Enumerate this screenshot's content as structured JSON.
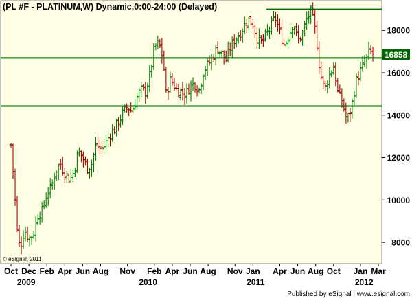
{
  "chart_data": {
    "type": "ohlc",
    "title": "(PL #F - PLATINUM,W) Dynamic,0:00-24:00 (Delayed)",
    "ylim": [
      7000,
      19400
    ],
    "y_ticks": [
      8000,
      10000,
      12000,
      14000,
      16000,
      18000
    ],
    "y_tick_labels": [
      "8000",
      "10000",
      "12000",
      "14000",
      "16000",
      "18000"
    ],
    "x_month_labels": [
      {
        "label": "Oct",
        "t": 0.0
      },
      {
        "label": "Dec",
        "t": 2.0
      },
      {
        "label": "Feb",
        "t": 4.0
      },
      {
        "label": "Apr",
        "t": 6.0
      },
      {
        "label": "Jun",
        "t": 8.0
      },
      {
        "label": "Aug",
        "t": 10.0
      },
      {
        "label": "Nov",
        "t": 13.0
      },
      {
        "label": "Feb",
        "t": 16.0
      },
      {
        "label": "Apr",
        "t": 18.0
      },
      {
        "label": "Jun",
        "t": 20.0
      },
      {
        "label": "Aug",
        "t": 22.0
      },
      {
        "label": "Nov",
        "t": 25.0
      },
      {
        "label": "Jan",
        "t": 27.0
      },
      {
        "label": "Apr",
        "t": 30.0
      },
      {
        "label": "Jun",
        "t": 32.0
      },
      {
        "label": "Aug",
        "t": 34.0
      },
      {
        "label": "Oct",
        "t": 36.0
      },
      {
        "label": "Jan",
        "t": 39.0
      },
      {
        "label": "Mar",
        "t": 41.0
      }
    ],
    "x_year_labels": [
      {
        "label": "2009",
        "t": 1.7
      },
      {
        "label": "2010",
        "t": 15.3
      },
      {
        "label": "2011",
        "t": 27.3
      },
      {
        "label": "2012",
        "t": 39.4
      }
    ],
    "horizontal_lines": [
      18990,
      16700,
      14430
    ],
    "last_price": "16858",
    "watermark": "© eSignal, 2011",
    "footer": "Published by eSignal | www.esignal.com",
    "colors": {
      "plot_background": "#ffffe6",
      "frame_background": "#ffffff",
      "up_bar": "#008000",
      "down_bar": "#b00000",
      "level_line": "#006400",
      "price_box": "#006400",
      "price_text": "#ffffff"
    },
    "anchors": [
      [
        0.0,
        12600
      ],
      [
        0.3,
        11000
      ],
      [
        0.7,
        8500
      ],
      [
        1.0,
        7700
      ],
      [
        1.5,
        8600
      ],
      [
        2.0,
        8200
      ],
      [
        2.5,
        8400
      ],
      [
        3.0,
        9300
      ],
      [
        3.5,
        9500
      ],
      [
        4.0,
        10300
      ],
      [
        4.5,
        10600
      ],
      [
        5.0,
        11400
      ],
      [
        5.5,
        11700
      ],
      [
        6.0,
        11300
      ],
      [
        6.5,
        11000
      ],
      [
        7.0,
        11300
      ],
      [
        7.5,
        12300
      ],
      [
        8.0,
        12000
      ],
      [
        8.5,
        11500
      ],
      [
        9.0,
        11700
      ],
      [
        9.5,
        12600
      ],
      [
        10.0,
        12400
      ],
      [
        10.5,
        12600
      ],
      [
        11.0,
        13100
      ],
      [
        11.5,
        13300
      ],
      [
        12.0,
        13700
      ],
      [
        12.5,
        14100
      ],
      [
        13.0,
        14400
      ],
      [
        13.5,
        14200
      ],
      [
        14.0,
        14800
      ],
      [
        14.5,
        15200
      ],
      [
        15.0,
        15100
      ],
      [
        15.5,
        15900
      ],
      [
        16.0,
        17200
      ],
      [
        16.5,
        17400
      ],
      [
        17.0,
        16600
      ],
      [
        17.3,
        15000
      ],
      [
        17.8,
        15700
      ],
      [
        18.5,
        15200
      ],
      [
        19.5,
        15000
      ],
      [
        20.0,
        15400
      ],
      [
        20.5,
        15500
      ],
      [
        21.0,
        15200
      ],
      [
        21.5,
        16100
      ],
      [
        22.0,
        16400
      ],
      [
        22.5,
        16700
      ],
      [
        23.0,
        17200
      ],
      [
        23.5,
        16900
      ],
      [
        24.0,
        16600
      ],
      [
        24.5,
        17200
      ],
      [
        25.0,
        17600
      ],
      [
        25.5,
        17800
      ],
      [
        26.0,
        18200
      ],
      [
        26.5,
        18500
      ],
      [
        27.0,
        18300
      ],
      [
        27.5,
        17600
      ],
      [
        28.0,
        17400
      ],
      [
        28.5,
        17800
      ],
      [
        29.0,
        18200
      ],
      [
        29.5,
        18600
      ],
      [
        30.0,
        17900
      ],
      [
        30.5,
        17300
      ],
      [
        31.0,
        17800
      ],
      [
        31.5,
        18400
      ],
      [
        32.0,
        17500
      ],
      [
        32.5,
        17800
      ],
      [
        33.0,
        18500
      ],
      [
        33.5,
        18900
      ],
      [
        34.0,
        17900
      ],
      [
        34.5,
        16000
      ],
      [
        35.0,
        15200
      ],
      [
        35.5,
        15900
      ],
      [
        36.0,
        16300
      ],
      [
        36.5,
        15000
      ],
      [
        37.0,
        14600
      ],
      [
        37.5,
        13700
      ],
      [
        38.0,
        14400
      ],
      [
        38.5,
        15600
      ],
      [
        39.0,
        16100
      ],
      [
        39.5,
        16500
      ],
      [
        40.0,
        17000
      ],
      [
        40.5,
        16858
      ]
    ]
  }
}
